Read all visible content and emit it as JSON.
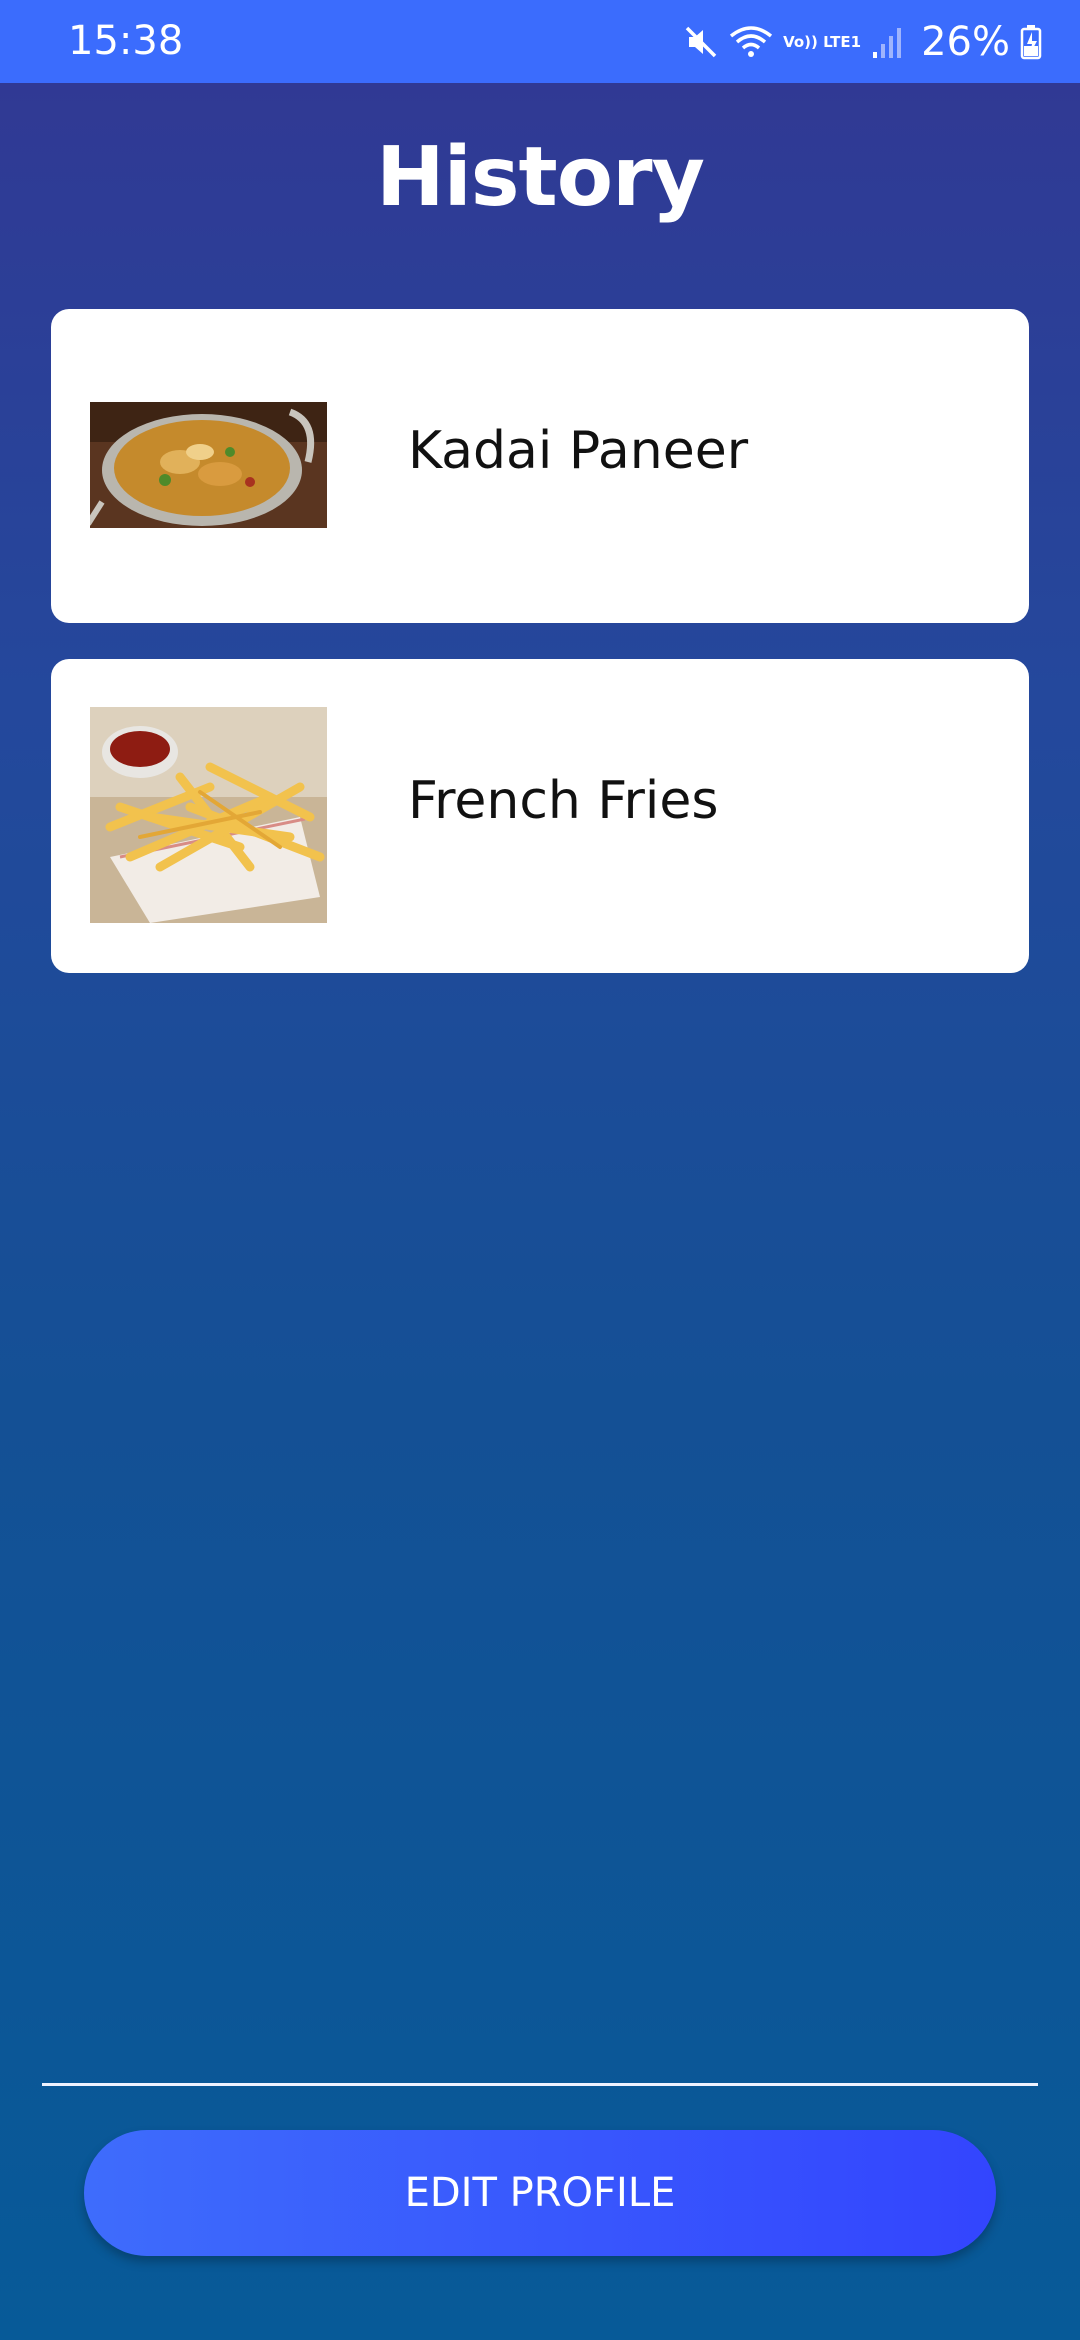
{
  "status_bar": {
    "time": "15:38",
    "network_label": "Vo)) LTE1",
    "battery": "26%",
    "icons": [
      "mute-icon",
      "wifi-icon",
      "signal-icon",
      "battery-charging-icon"
    ]
  },
  "page": {
    "title": "History"
  },
  "history": {
    "items": [
      {
        "label": "Kadai Paneer",
        "image": "kadai-paneer-image"
      },
      {
        "label": "French Fries",
        "image": "french-fries-image"
      }
    ]
  },
  "footer": {
    "edit_profile_label": "EDIT PROFILE"
  },
  "colors": {
    "status_bar": "#3b6cfd",
    "background_top": "#323793",
    "background_bottom": "#075a98",
    "button_start": "#3e6cfc",
    "button_end": "#3345fe"
  }
}
